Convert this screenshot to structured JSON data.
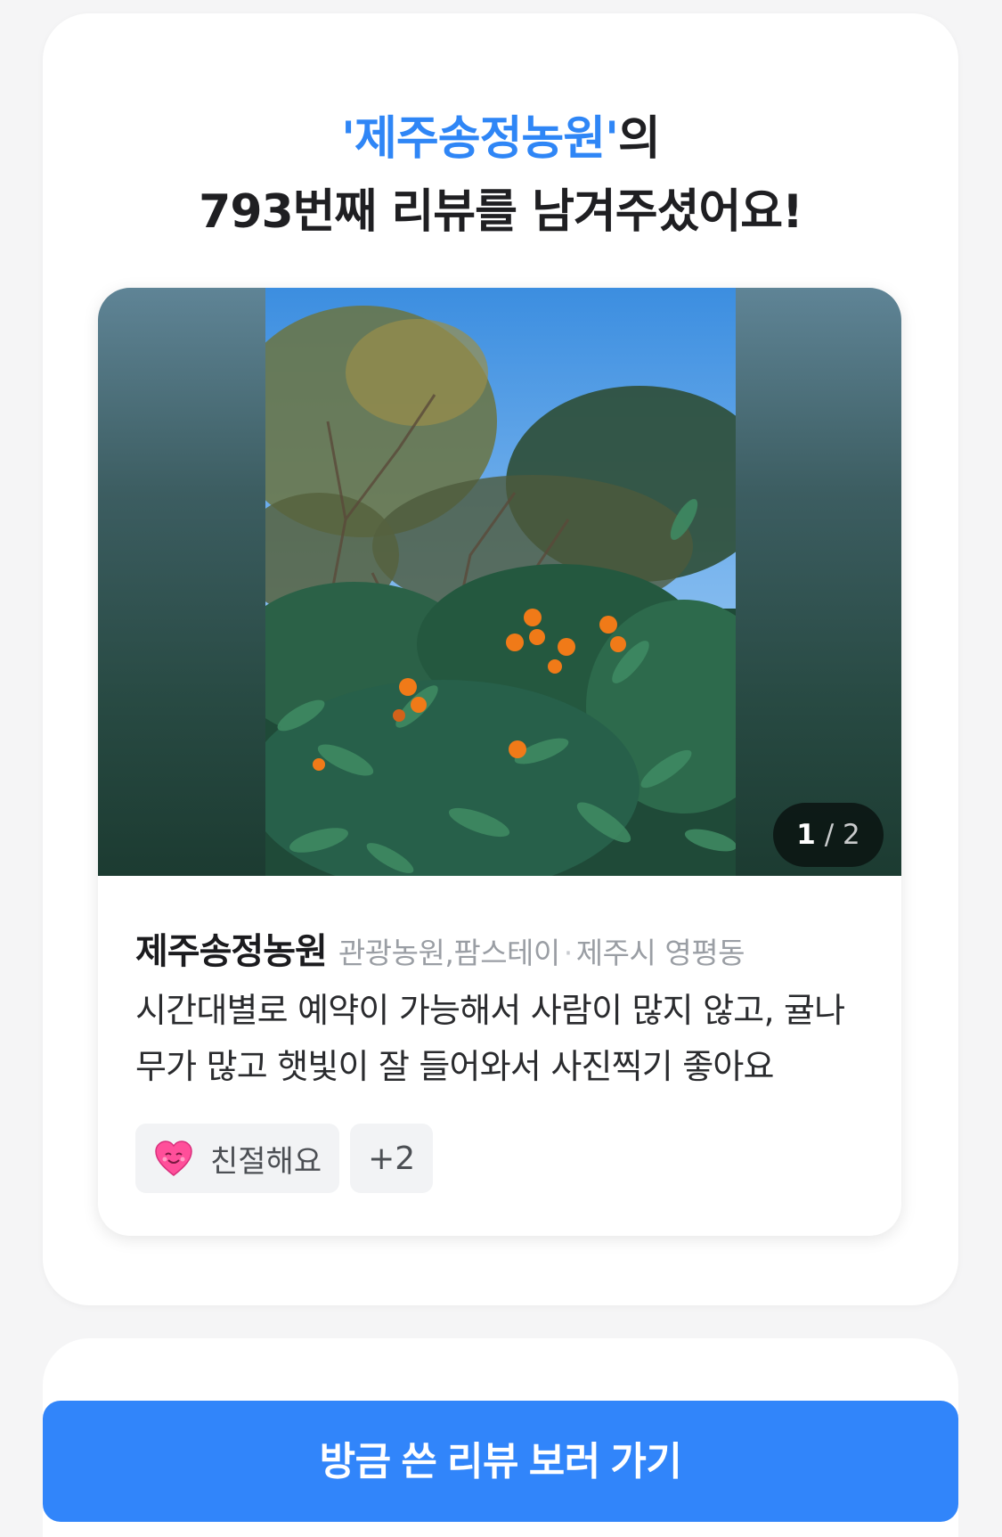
{
  "headline": {
    "quote_open": "'",
    "place_name": "제주송정농원",
    "quote_close": "'",
    "suffix": "의",
    "line2": "793번째 리뷰를 남겨주셨어요!"
  },
  "review": {
    "photo_counter": {
      "current": "1",
      "separator": " / ",
      "total": "2"
    },
    "place_name": "제주송정농원",
    "category": "관광농원,팜스테이",
    "separator": "·",
    "location": "제주시 영평동",
    "text": "시간대별로 예약이 가능해서 사람이 많지 않고, 귤나무가 많고 햇빛이 잘 들어와서 사진찍기 좋아요",
    "tags": [
      {
        "icon": "smiling-heart-icon",
        "label": "친절해요"
      }
    ],
    "more_tags": "+2"
  },
  "cta": {
    "label": "방금 쓴 리뷰 보러 가기"
  },
  "colors": {
    "accent": "#2f86f6",
    "button": "#3185fa",
    "background": "#f5f5f6"
  }
}
